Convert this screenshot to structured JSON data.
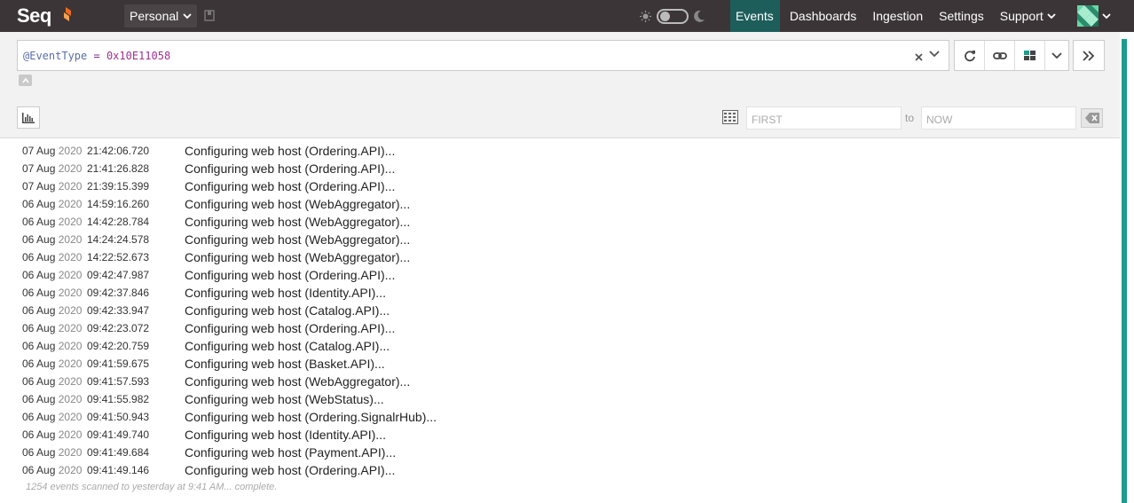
{
  "app": {
    "name": "Seq",
    "brand_color": "#f26b1d"
  },
  "workspace": {
    "label": "Personal"
  },
  "nav": {
    "events": "Events",
    "dashboards": "Dashboards",
    "ingestion": "Ingestion",
    "settings": "Settings",
    "support": "Support"
  },
  "search": {
    "property": "@EventType",
    "operator": " = ",
    "value": "0x10E11058"
  },
  "range": {
    "from_placeholder": "FIRST",
    "to_label": "to",
    "to_placeholder": "NOW"
  },
  "events": [
    {
      "date": "07 Aug",
      "year": "2020",
      "time": "21:42:06.720",
      "message": "Configuring web host (Ordering.API)..."
    },
    {
      "date": "07 Aug",
      "year": "2020",
      "time": "21:41:26.828",
      "message": "Configuring web host (Ordering.API)..."
    },
    {
      "date": "07 Aug",
      "year": "2020",
      "time": "21:39:15.399",
      "message": "Configuring web host (Ordering.API)..."
    },
    {
      "date": "06 Aug",
      "year": "2020",
      "time": "14:59:16.260",
      "message": "Configuring web host (WebAggregator)..."
    },
    {
      "date": "06 Aug",
      "year": "2020",
      "time": "14:42:28.784",
      "message": "Configuring web host (WebAggregator)..."
    },
    {
      "date": "06 Aug",
      "year": "2020",
      "time": "14:24:24.578",
      "message": "Configuring web host (WebAggregator)..."
    },
    {
      "date": "06 Aug",
      "year": "2020",
      "time": "14:22:52.673",
      "message": "Configuring web host (WebAggregator)..."
    },
    {
      "date": "06 Aug",
      "year": "2020",
      "time": "09:42:47.987",
      "message": "Configuring web host (Ordering.API)..."
    },
    {
      "date": "06 Aug",
      "year": "2020",
      "time": "09:42:37.846",
      "message": "Configuring web host (Identity.API)..."
    },
    {
      "date": "06 Aug",
      "year": "2020",
      "time": "09:42:33.947",
      "message": "Configuring web host (Catalog.API)..."
    },
    {
      "date": "06 Aug",
      "year": "2020",
      "time": "09:42:23.072",
      "message": "Configuring web host (Ordering.API)..."
    },
    {
      "date": "06 Aug",
      "year": "2020",
      "time": "09:42:20.759",
      "message": "Configuring web host (Catalog.API)..."
    },
    {
      "date": "06 Aug",
      "year": "2020",
      "time": "09:41:59.675",
      "message": "Configuring web host (Basket.API)..."
    },
    {
      "date": "06 Aug",
      "year": "2020",
      "time": "09:41:57.593",
      "message": "Configuring web host (WebAggregator)..."
    },
    {
      "date": "06 Aug",
      "year": "2020",
      "time": "09:41:55.982",
      "message": "Configuring web host (WebStatus)..."
    },
    {
      "date": "06 Aug",
      "year": "2020",
      "time": "09:41:50.943",
      "message": "Configuring web host (Ordering.SignalrHub)..."
    },
    {
      "date": "06 Aug",
      "year": "2020",
      "time": "09:41:49.740",
      "message": "Configuring web host (Identity.API)..."
    },
    {
      "date": "06 Aug",
      "year": "2020",
      "time": "09:41:49.684",
      "message": "Configuring web host (Payment.API)..."
    },
    {
      "date": "06 Aug",
      "year": "2020",
      "time": "09:41:49.146",
      "message": "Configuring web host (Ordering.API)..."
    }
  ],
  "status": "1254 events scanned to yesterday at 9:41 AM... complete."
}
